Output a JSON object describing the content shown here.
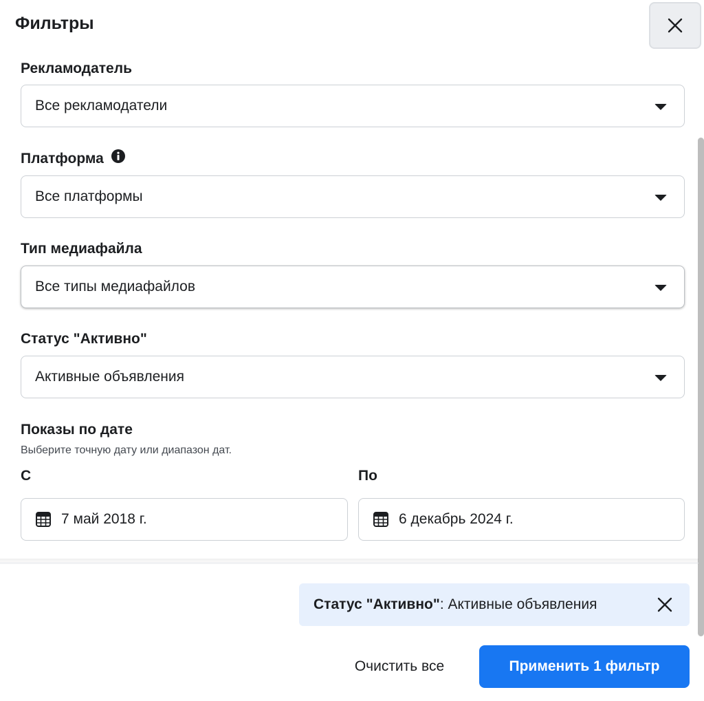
{
  "dialog": {
    "title": "Фильтры",
    "close_icon": "close-icon"
  },
  "filters": {
    "advertiser": {
      "label": "Рекламодатель",
      "value": "Все рекламодатели"
    },
    "platform": {
      "label": "Платформа",
      "value": "Все платформы",
      "info_icon": "info-icon"
    },
    "media_type": {
      "label": "Тип медиафайла",
      "value": "Все типы медиафайлов"
    },
    "active_status": {
      "label": "Статус \"Активно\"",
      "value": "Активные объявления"
    }
  },
  "impressions_by_date": {
    "label": "Показы по дате",
    "hint": "Выберите точную дату или диапазон дат.",
    "from": {
      "label": "С",
      "value": "7 май 2018 г.",
      "icon": "calendar-icon"
    },
    "to": {
      "label": "По",
      "value": "6 декабрь 2024 г.",
      "icon": "calendar-icon"
    }
  },
  "applied_chip": {
    "name": "Статус \"Активно\"",
    "separator": ": ",
    "value": "Активные объявления"
  },
  "footer": {
    "clear_label": "Очистить все",
    "apply_label": "Применить 1 фильтр"
  },
  "colors": {
    "primary": "#1877f2",
    "chip_background": "#e7f0fd",
    "text": "#1c1e21"
  }
}
